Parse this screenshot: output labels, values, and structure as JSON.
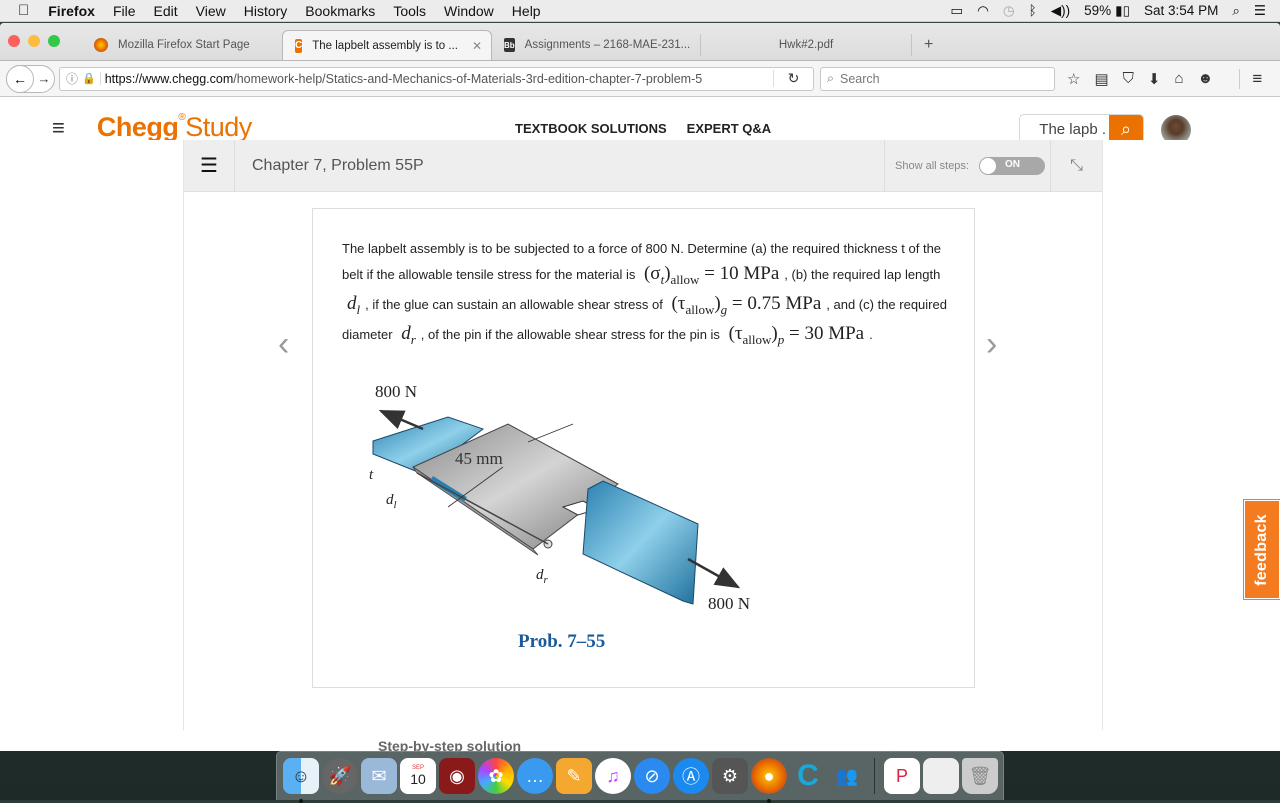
{
  "menubar": {
    "app": "Firefox",
    "items": [
      "File",
      "Edit",
      "View",
      "History",
      "Bookmarks",
      "Tools",
      "Window",
      "Help"
    ],
    "battery": "59%",
    "clock": "Sat 3:54 PM",
    "icons": [
      "airplay-icon",
      "wifi-icon",
      "time-machine-icon",
      "bluetooth-icon",
      "volume-icon",
      "battery-icon",
      "spotlight-icon",
      "notification-center-icon"
    ]
  },
  "browser": {
    "tabs": [
      {
        "label": "Mozilla Firefox Start Page",
        "icon": "firefox-icon",
        "active": false
      },
      {
        "label": "The lapbelt assembly is to ...",
        "icon": "chegg-icon",
        "active": true
      },
      {
        "label": "Assignments – 2168-MAE-231...",
        "icon": "blackboard-icon",
        "active": false
      },
      {
        "label": "Hwk#2.pdf",
        "icon": "",
        "active": false
      }
    ],
    "new_tab": "+",
    "url_domain": "https://www.chegg.com",
    "url_path": "/homework-help/Statics-and-Mechanics-of-Materials-3rd-edition-chapter-7-problem-5",
    "search_placeholder": "Search"
  },
  "chegg": {
    "logo_brand": "Chegg",
    "logo_product": "Study",
    "nav": [
      "TEXTBOOK SOLUTIONS",
      "EXPERT Q&A"
    ],
    "search_value": "The lapb .",
    "brand_color": "#eb7100"
  },
  "problem": {
    "title": "Chapter 7, Problem 55P",
    "show_all_steps_label": "Show all steps:",
    "toggle_state": "ON",
    "text": {
      "p1": "The lapbelt assembly is to be subjected to a force of 800 N. Determine (a) the required thickness t of the belt if the allowable tensile stress for the material is",
      "m1": "(σt)allow = 10 MPa",
      "p2": ", (b) the required lap length",
      "m2": "dl",
      "p3": ", if the glue can sustain an allowable shear stress of",
      "m3": "(τallow)g = 0.75 MPa",
      "p4": ", and (c) the required diameter",
      "m4": "dr",
      "p5": ", of the pin if the allowable shear stress for the pin is",
      "m5": "(τallow)p = 30 MPa",
      "p6": "."
    },
    "figure": {
      "force_left": "800 N",
      "force_right": "800 N",
      "width_label": "45 mm",
      "t_label": "t",
      "dl_label": "dl",
      "dr_label": "dr",
      "caption": "Prob. 7–55"
    },
    "step_heading": "Step-by-step solution"
  },
  "feedback_label": "feedback",
  "dock": {
    "apps": [
      "Finder",
      "Launchpad",
      "Preview",
      "Calendar",
      "Photo Booth",
      "Photos",
      "Messages",
      "Pages",
      "iTunes",
      "Safari",
      "App Store",
      "System Preferences",
      "Firefox",
      "Cengage",
      "Lync",
      "PowerPoint",
      "Screenshot",
      "Trash"
    ],
    "calendar_month": "SEP",
    "calendar_day": "10"
  }
}
